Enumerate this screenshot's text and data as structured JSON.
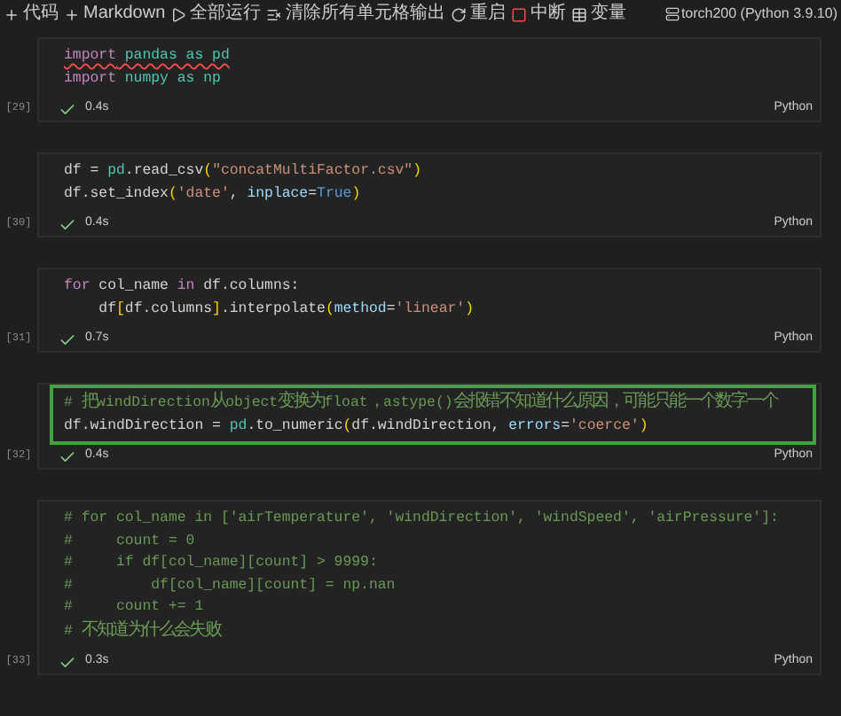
{
  "toolbar": {
    "items": [
      {
        "kind": "add",
        "label": "代码"
      },
      {
        "kind": "add",
        "label": "Markdown"
      },
      {
        "kind": "run",
        "label": "全部运行"
      },
      {
        "kind": "clear",
        "label": "清除所有单元格输出"
      },
      {
        "kind": "restart",
        "label": "重启"
      },
      {
        "kind": "stop",
        "label": "中断"
      },
      {
        "kind": "variables",
        "label": "变量"
      }
    ],
    "kernel": "torch200 (Python 3.9.10)"
  },
  "cells": [
    {
      "count": "[29]",
      "selected": false,
      "succeeded": true,
      "time": "0.4s",
      "language": "Python",
      "lines": [
        {
          "error_underline": true,
          "tokens": [
            {
              "kind": "keyword",
              "text": "import"
            },
            {
              "kind": "module",
              "text": " pandas as pd"
            }
          ]
        },
        {
          "error_underline": false,
          "tokens": [
            {
              "kind": "keyword",
              "text": "import"
            },
            {
              "kind": "module",
              "text": " numpy as np"
            }
          ]
        }
      ]
    },
    {
      "count": "[30]",
      "selected": false,
      "succeeded": true,
      "time": "0.4s",
      "language": "Python",
      "lines": [
        {
          "error_underline": false,
          "tokens": [
            {
              "kind": "plain",
              "text": "df = "
            },
            {
              "kind": "module",
              "text": "pd"
            },
            {
              "kind": "plain",
              "text": ".read_csv"
            },
            {
              "kind": "bracket",
              "text": "("
            },
            {
              "kind": "string",
              "text": "\"concatMultiFactor.csv\""
            },
            {
              "kind": "bracket",
              "text": ")"
            }
          ]
        },
        {
          "error_underline": false,
          "tokens": [
            {
              "kind": "plain",
              "text": "df.set_index"
            },
            {
              "kind": "bracket",
              "text": "("
            },
            {
              "kind": "string",
              "text": "'date'"
            },
            {
              "kind": "plain",
              "text": ", "
            },
            {
              "kind": "variable",
              "text": "inplace"
            },
            {
              "kind": "plain",
              "text": "="
            },
            {
              "kind": "constant",
              "text": "True"
            },
            {
              "kind": "bracket",
              "text": ")"
            }
          ]
        }
      ]
    },
    {
      "count": "[31]",
      "selected": false,
      "succeeded": true,
      "time": "0.7s",
      "language": "Python",
      "lines": [
        {
          "error_underline": false,
          "tokens": [
            {
              "kind": "keyword",
              "text": "for"
            },
            {
              "kind": "plain",
              "text": " col_name "
            },
            {
              "kind": "keyword",
              "text": "in"
            },
            {
              "kind": "plain",
              "text": " df.columns:"
            }
          ]
        },
        {
          "error_underline": false,
          "tokens": [
            {
              "kind": "plain",
              "text": "    df"
            },
            {
              "kind": "bracket",
              "text": "["
            },
            {
              "kind": "plain",
              "text": "df.columns"
            },
            {
              "kind": "bracket",
              "text": "]"
            },
            {
              "kind": "plain",
              "text": ".interpolate"
            },
            {
              "kind": "bracket",
              "text": "("
            },
            {
              "kind": "variable",
              "text": "method"
            },
            {
              "kind": "plain",
              "text": "="
            },
            {
              "kind": "string",
              "text": "'linear'"
            },
            {
              "kind": "bracket",
              "text": ")"
            }
          ]
        }
      ]
    },
    {
      "count": "[32]",
      "selected": true,
      "succeeded": true,
      "time": "0.4s",
      "language": "Python",
      "lines": [
        {
          "error_underline": false,
          "tokens": [
            {
              "kind": "comment",
              "text": "# 把windDirection从object变换为float，astype()会报错不知道什么原因，可能只能一个数字一个"
            }
          ]
        },
        {
          "error_underline": false,
          "tokens": [
            {
              "kind": "plain",
              "text": "df.windDirection = "
            },
            {
              "kind": "module",
              "text": "pd"
            },
            {
              "kind": "plain",
              "text": ".to_numeric"
            },
            {
              "kind": "bracket",
              "text": "("
            },
            {
              "kind": "plain",
              "text": "df.windDirection, "
            },
            {
              "kind": "variable",
              "text": "errors"
            },
            {
              "kind": "plain",
              "text": "="
            },
            {
              "kind": "string",
              "text": "'coerce'"
            },
            {
              "kind": "bracket",
              "text": ")"
            }
          ]
        }
      ]
    },
    {
      "count": "[33]",
      "selected": false,
      "succeeded": true,
      "time": "0.3s",
      "language": "Python",
      "lines": [
        {
          "error_underline": false,
          "tokens": [
            {
              "kind": "comment",
              "text": "# for col_name in ['airTemperature', 'windDirection', 'windSpeed', 'airPressure']:"
            }
          ]
        },
        {
          "error_underline": false,
          "tokens": [
            {
              "kind": "comment",
              "text": "#     count = 0"
            }
          ]
        },
        {
          "error_underline": false,
          "tokens": [
            {
              "kind": "comment",
              "text": "#     if df[col_name][count] > 9999:"
            }
          ]
        },
        {
          "error_underline": false,
          "tokens": [
            {
              "kind": "comment",
              "text": "#         df[col_name][count] = np.nan"
            }
          ]
        },
        {
          "error_underline": false,
          "tokens": [
            {
              "kind": "comment",
              "text": "#     count += 1"
            }
          ]
        },
        {
          "error_underline": false,
          "tokens": [
            {
              "kind": "comment",
              "text": "# 不知道为什么会失败"
            }
          ]
        }
      ]
    }
  ]
}
